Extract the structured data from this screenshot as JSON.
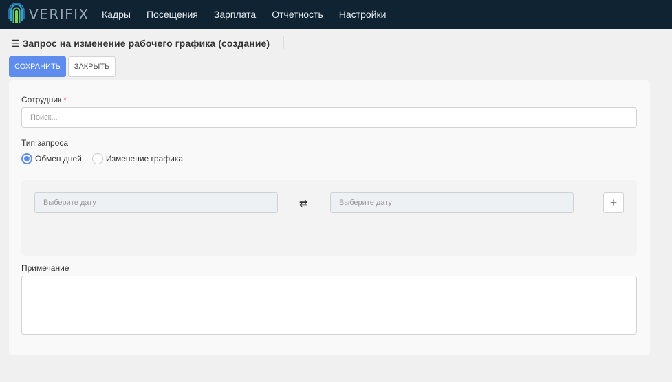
{
  "app": {
    "logo_text": "VERIFIX",
    "nav": [
      {
        "label": "Кадры"
      },
      {
        "label": "Посещения"
      },
      {
        "label": "Зарплата"
      },
      {
        "label": "Отчетность"
      },
      {
        "label": "Настройки"
      }
    ]
  },
  "page": {
    "title": "Запрос на изменение рабочего графика (создание)"
  },
  "toolbar": {
    "save_label": "Сохранить",
    "close_label": "Закрыть"
  },
  "form": {
    "employee": {
      "label": "Сотрудник",
      "required_mark": "*",
      "placeholder": "Поиск...",
      "value": ""
    },
    "request_type": {
      "label": "Тип запроса",
      "options": [
        {
          "label": "Обмен дней",
          "selected": true
        },
        {
          "label": "Изменение графика",
          "selected": false
        }
      ]
    },
    "swap": {
      "from_placeholder": "Выберите дату",
      "to_placeholder": "Выберите дату",
      "swap_icon": "swap-arrows-icon",
      "add_icon": "plus-icon"
    },
    "note": {
      "label": "Примечание",
      "value": ""
    }
  },
  "colors": {
    "topbar": "#0f2333",
    "accent": "#5e8dee",
    "required": "#e64a4a"
  }
}
